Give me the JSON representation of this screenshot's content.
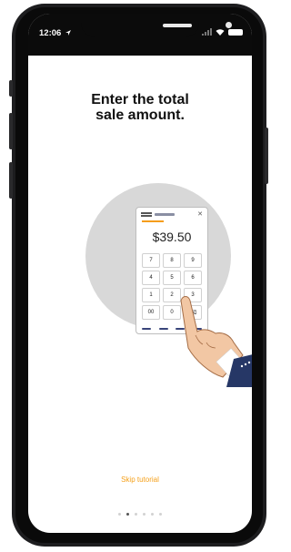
{
  "status_bar": {
    "time": "12:06"
  },
  "main": {
    "title_line1": "Enter the total",
    "title_line2": "sale amount."
  },
  "illustration": {
    "amount": "$39.50",
    "keys": [
      "7",
      "8",
      "9",
      "4",
      "5",
      "6",
      "1",
      "2",
      "3",
      "00",
      "0",
      "⌫"
    ],
    "accent_color": "#f59d1b"
  },
  "skip_label": "Skip tutorial",
  "pagination": {
    "total": 6,
    "active_index": 1
  },
  "colors": {
    "accent": "#f5a01a",
    "phone_frame": "#1d1d1f",
    "illustration_bg": "#d8d8d8",
    "sleeve": "#263766"
  }
}
